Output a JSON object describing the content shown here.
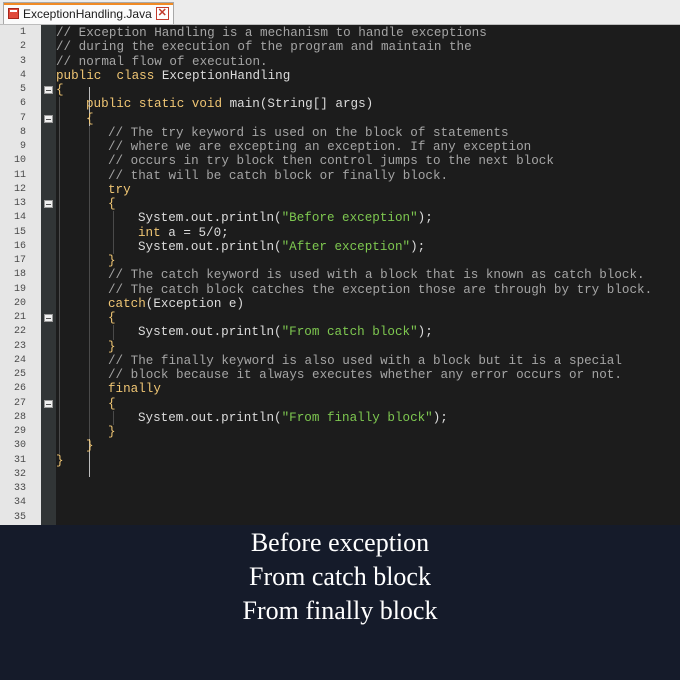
{
  "tab": {
    "filename": "ExceptionHandling.Java",
    "close": "✕"
  },
  "lines": [
    {
      "n": "1",
      "indent": 0,
      "parts": [
        {
          "t": "comment",
          "v": "// Exception Handling is a mechanism to handle exceptions"
        }
      ]
    },
    {
      "n": "2",
      "indent": 0,
      "parts": [
        {
          "t": "comment",
          "v": "// during the execution of the program and maintain the"
        }
      ]
    },
    {
      "n": "3",
      "indent": 0,
      "parts": [
        {
          "t": "comment",
          "v": "// normal flow of execution."
        }
      ]
    },
    {
      "n": "4",
      "indent": 0,
      "parts": [
        {
          "t": "kw",
          "v": "public  class "
        },
        {
          "t": "code",
          "v": "ExceptionHandling"
        }
      ]
    },
    {
      "n": "5",
      "indent": 0,
      "fold": true,
      "parts": [
        {
          "t": "kw",
          "v": "{"
        }
      ]
    },
    {
      "n": "6",
      "indent": 1,
      "parts": [
        {
          "t": "kw",
          "v": "public static void "
        },
        {
          "t": "code",
          "v": "main(String[] args)"
        }
      ]
    },
    {
      "n": "7",
      "indent": 1,
      "fold": true,
      "parts": [
        {
          "t": "kw",
          "v": "{"
        }
      ]
    },
    {
      "n": "8",
      "indent": 2,
      "parts": [
        {
          "t": "comment",
          "v": "// The try keyword is used on the block of statements"
        }
      ]
    },
    {
      "n": "9",
      "indent": 2,
      "parts": [
        {
          "t": "comment",
          "v": "// where we are excepting an exception. If any exception"
        }
      ]
    },
    {
      "n": "10",
      "indent": 2,
      "parts": [
        {
          "t": "comment",
          "v": "// occurs in try block then control jumps to the next block"
        }
      ]
    },
    {
      "n": "11",
      "indent": 2,
      "parts": [
        {
          "t": "comment",
          "v": "// that will be catch block or finally block."
        }
      ]
    },
    {
      "n": "12",
      "indent": 2,
      "parts": [
        {
          "t": "kw",
          "v": "try"
        }
      ]
    },
    {
      "n": "13",
      "indent": 2,
      "fold": true,
      "parts": [
        {
          "t": "kw",
          "v": "{"
        }
      ]
    },
    {
      "n": "14",
      "indent": 3,
      "parts": [
        {
          "t": "code",
          "v": "System.out.println("
        },
        {
          "t": "str",
          "v": "\"Before exception\""
        },
        {
          "t": "code",
          "v": ");"
        }
      ]
    },
    {
      "n": "15",
      "indent": 3,
      "parts": [
        {
          "t": "kw",
          "v": "int "
        },
        {
          "t": "code",
          "v": "a = 5/0;"
        }
      ]
    },
    {
      "n": "16",
      "indent": 3,
      "parts": [
        {
          "t": "code",
          "v": "System.out.println("
        },
        {
          "t": "str",
          "v": "\"After exception\""
        },
        {
          "t": "code",
          "v": ");"
        }
      ]
    },
    {
      "n": "17",
      "indent": 2,
      "parts": [
        {
          "t": "kw",
          "v": "}"
        }
      ]
    },
    {
      "n": "18",
      "indent": 2,
      "parts": [
        {
          "t": "comment",
          "v": "// The catch keyword is used with a block that is known as catch block."
        }
      ]
    },
    {
      "n": "19",
      "indent": 2,
      "parts": [
        {
          "t": "comment",
          "v": "// The catch block catches the exception those are through by try block."
        }
      ]
    },
    {
      "n": "20",
      "indent": 2,
      "parts": [
        {
          "t": "kw",
          "v": "catch"
        },
        {
          "t": "code",
          "v": "(Exception e)"
        }
      ]
    },
    {
      "n": "21",
      "indent": 2,
      "fold": true,
      "parts": [
        {
          "t": "kw",
          "v": "{"
        }
      ]
    },
    {
      "n": "22",
      "indent": 3,
      "parts": [
        {
          "t": "code",
          "v": "System.out.println("
        },
        {
          "t": "str",
          "v": "\"From catch block\""
        },
        {
          "t": "code",
          "v": ");"
        }
      ]
    },
    {
      "n": "23",
      "indent": 2,
      "parts": [
        {
          "t": "kw",
          "v": "}"
        }
      ]
    },
    {
      "n": "24",
      "indent": 2,
      "parts": [
        {
          "t": "comment",
          "v": "// The finally keyword is also used with a block but it is a special"
        }
      ]
    },
    {
      "n": "25",
      "indent": 2,
      "parts": [
        {
          "t": "comment",
          "v": "// block because it always executes whether any error occurs or not."
        }
      ]
    },
    {
      "n": "26",
      "indent": 2,
      "parts": [
        {
          "t": "kw",
          "v": "finally"
        }
      ]
    },
    {
      "n": "27",
      "indent": 2,
      "fold": true,
      "parts": [
        {
          "t": "kw",
          "v": "{"
        }
      ]
    },
    {
      "n": "28",
      "indent": 3,
      "parts": [
        {
          "t": "code",
          "v": "System.out.println("
        },
        {
          "t": "str",
          "v": "\"From finally block\""
        },
        {
          "t": "code",
          "v": ");"
        }
      ]
    },
    {
      "n": "29",
      "indent": 2,
      "parts": [
        {
          "t": "kw",
          "v": "}"
        }
      ]
    },
    {
      "n": "30",
      "indent": 1,
      "parts": [
        {
          "t": "kw",
          "v": "}"
        }
      ]
    },
    {
      "n": "31",
      "indent": 0,
      "parts": [
        {
          "t": "kw",
          "v": "}"
        }
      ]
    },
    {
      "n": "32",
      "indent": 0,
      "parts": []
    },
    {
      "n": "33",
      "indent": 0,
      "parts": []
    },
    {
      "n": "34",
      "indent": 0,
      "parts": []
    },
    {
      "n": "35",
      "indent": 0,
      "parts": []
    }
  ],
  "output": {
    "line1": "Before exception",
    "line2": "From catch block",
    "line3": "From finally block"
  },
  "colors": {
    "comment": "#a5a5a5",
    "keyword": "#f0c674",
    "string": "#7ec850",
    "code": "#dcdcdc",
    "background": "#151b2a"
  }
}
